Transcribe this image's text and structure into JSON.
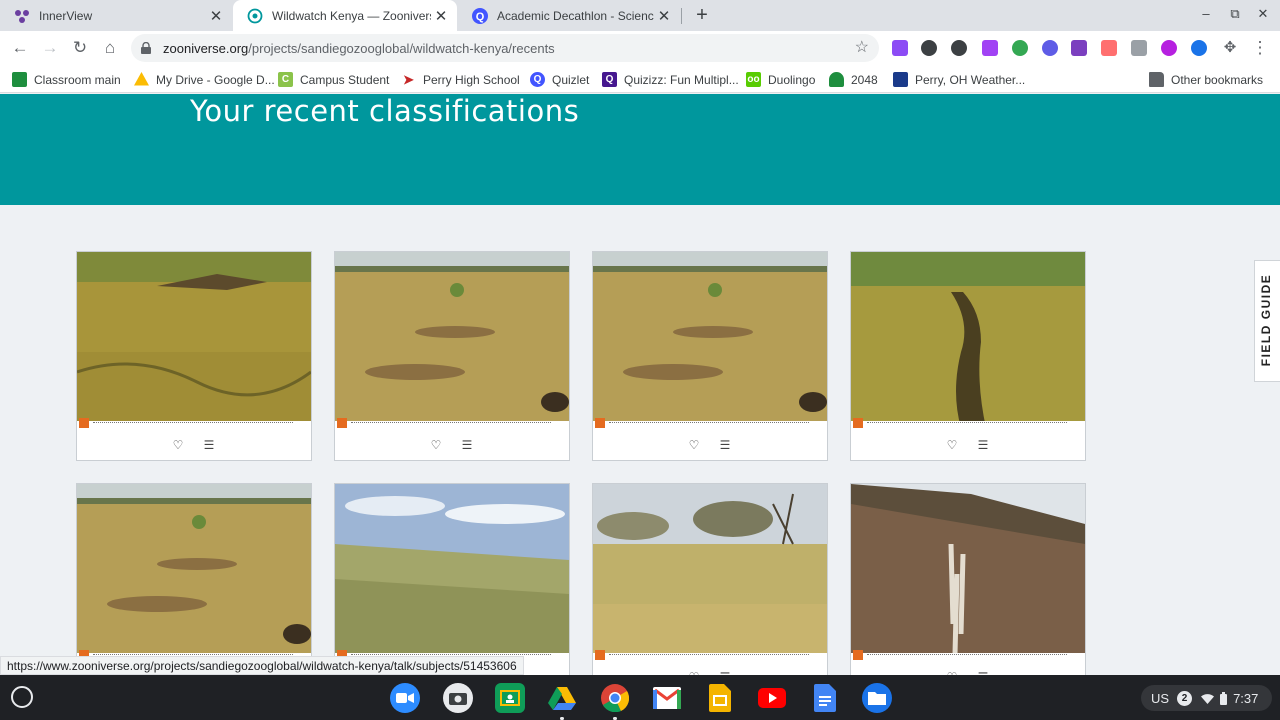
{
  "browser": {
    "tabs": [
      {
        "title": "InnerView",
        "icon": "innerview-icon"
      },
      {
        "title": "Wildwatch Kenya — Zooniverse",
        "icon": "zooniverse-icon",
        "active": true
      },
      {
        "title": "Academic Decathlon - Science Y",
        "icon": "quizlet-icon"
      }
    ],
    "url_domain": "zooniverse.org",
    "url_path": "/projects/sandiegozooglobal/wildwatch-kenya/recents",
    "bookmarks": [
      {
        "label": "Classroom main",
        "icon": "classroom-icon",
        "color": "#1e8e3e"
      },
      {
        "label": "My Drive - Google D...",
        "icon": "drive-icon",
        "color": "#fbbc04"
      },
      {
        "label": "Campus Student",
        "icon": "campus-icon",
        "color": "#8bc34a"
      },
      {
        "label": "Perry High School",
        "icon": "perry-icon",
        "color": "#c62828"
      },
      {
        "label": "Quizlet",
        "icon": "quizlet-icon",
        "color": "#4255ff"
      },
      {
        "label": "Quizizz: Fun Multipl...",
        "icon": "quizizz-icon",
        "color": "#46178f"
      },
      {
        "label": "Duolingo",
        "icon": "duolingo-icon",
        "color": "#58cc02"
      },
      {
        "label": "2048",
        "icon": "2048-icon",
        "color": "#1e8e3e"
      },
      {
        "label": "Perry, OH Weather...",
        "icon": "weather-icon",
        "color": "#1a3a8a"
      }
    ],
    "other_bookmarks": "Other bookmarks"
  },
  "page": {
    "heading": "Your recent classifications",
    "field_guide": "FIELD GUIDE",
    "cards": [
      {
        "scene": "grass-brush"
      },
      {
        "scene": "plain-shrub"
      },
      {
        "scene": "plain-shrub"
      },
      {
        "scene": "grass-shadow"
      },
      {
        "scene": "plain-shrub"
      },
      {
        "scene": "sky-field"
      },
      {
        "scene": "acacia"
      },
      {
        "scene": "dry-slope"
      }
    ]
  },
  "status_url": "https://www.zooniverse.org/projects/sandiegozooglobal/wildwatch-kenya/talk/subjects/51453606",
  "shelf": {
    "apps": [
      "zoom-icon",
      "camera-icon",
      "classroom-icon",
      "drive-icon",
      "chrome-icon",
      "gmail-icon",
      "slides-icon",
      "youtube-icon",
      "docs-icon",
      "files-icon"
    ],
    "input_method": "US",
    "notification_count": "2",
    "time": "7:37"
  },
  "colors": {
    "hero": "#00979d",
    "page_bg": "#eef1f4",
    "shelf": "#1f2125"
  }
}
